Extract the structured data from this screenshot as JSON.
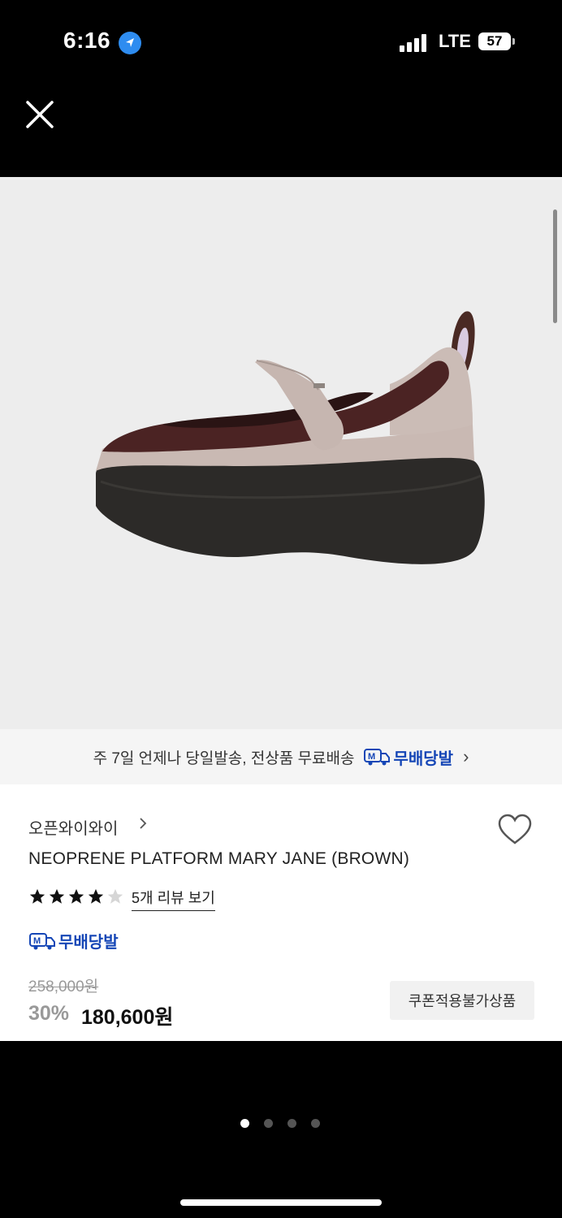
{
  "status_bar": {
    "time": "6:16",
    "network": "LTE",
    "battery": "57"
  },
  "product": {
    "brand": "오픈와이와이",
    "name": "NEOPRENE PLATFORM MARY JANE (BROWN)",
    "rating": 4,
    "rating_max": 5,
    "review_link": "5개 리뷰 보기",
    "original_price": "258,000원",
    "discount": "30%",
    "price": "180,600원",
    "coupon_label": "쿠폰적용불가상품",
    "shipping_badge": "무배당발"
  },
  "banner": {
    "text": "주 7일 언제나 당일발송, 전상품 무료배송",
    "logo_text": "무배당발",
    "chevron": "›"
  },
  "carousel": {
    "count": 4,
    "active_index": 0
  },
  "colors": {
    "accent_blue": "#1546b6",
    "image_bg": "#ededed"
  }
}
